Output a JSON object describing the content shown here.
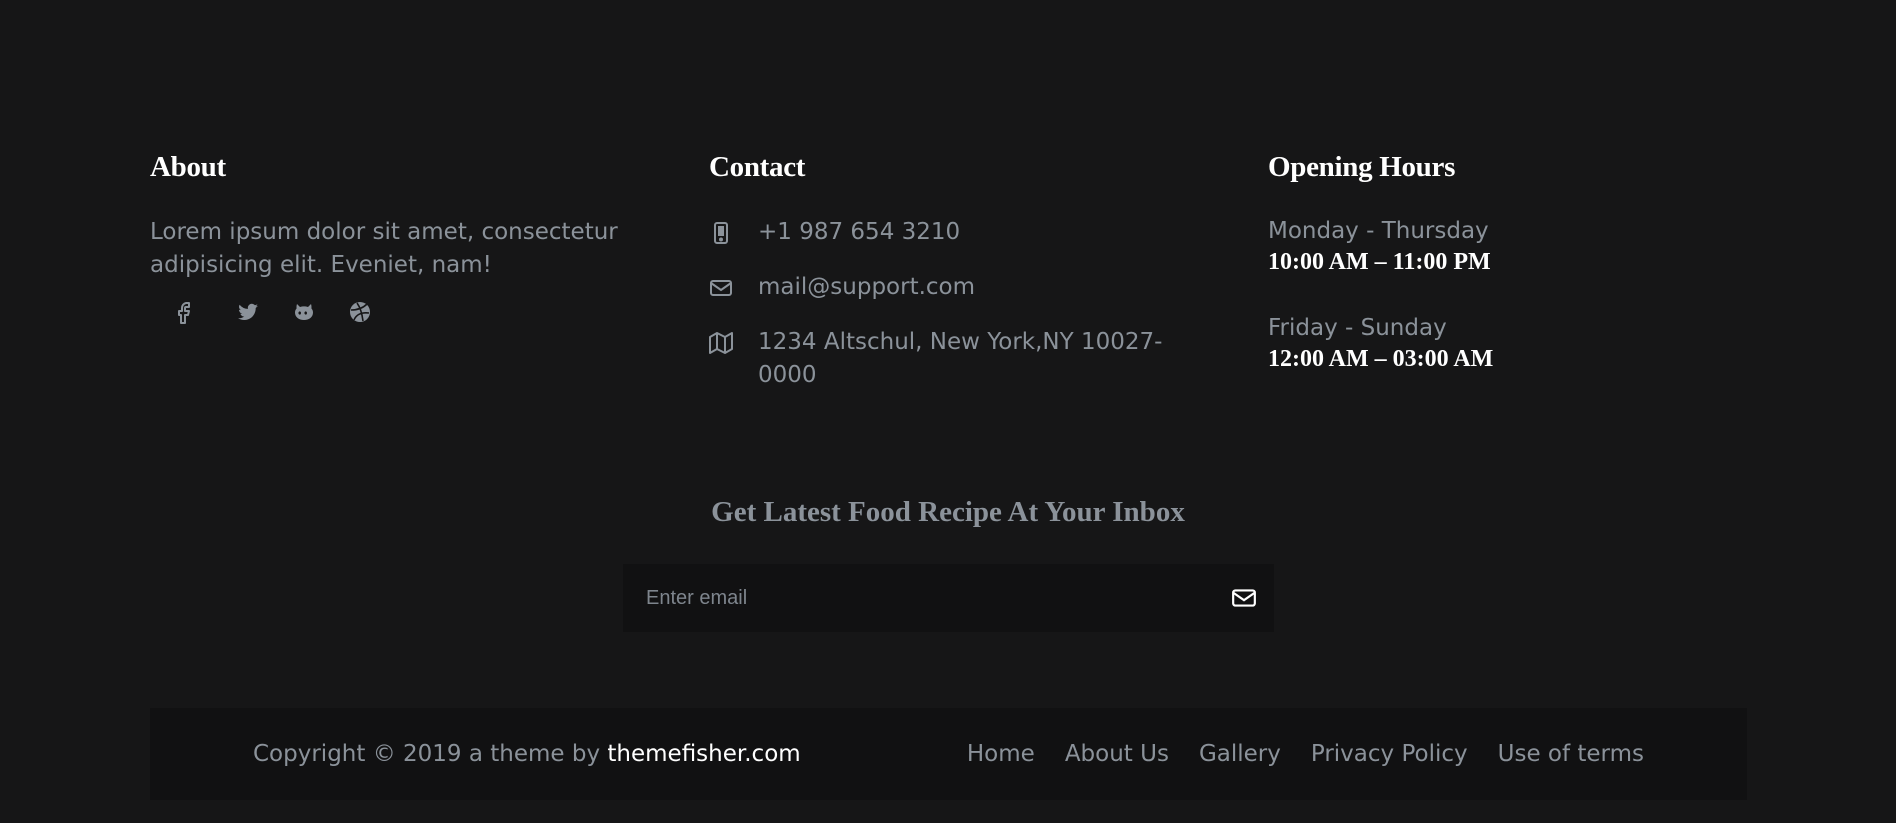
{
  "about": {
    "title": "About",
    "text": "Lorem ipsum dolor sit amet, consectetur adipisicing elit. Eveniet, nam!",
    "social": [
      {
        "icon": "facebook-icon"
      },
      {
        "icon": "twitter-icon"
      },
      {
        "icon": "github-icon"
      },
      {
        "icon": "dribbble-icon"
      }
    ]
  },
  "contact": {
    "title": "Contact",
    "phone": "+1 987 654 3210",
    "email": "mail@support.com",
    "address": "1234 Altschul, New York,NY 10027-0000"
  },
  "hours": {
    "title": "Opening Hours",
    "slots": [
      {
        "days": "Monday - Thursday",
        "time": "10:00 AM – 11:00 PM"
      },
      {
        "days": "Friday - Sunday",
        "time": "12:00 AM – 03:00 AM"
      }
    ]
  },
  "newsletter": {
    "title": "Get Latest Food Recipe At Your Inbox",
    "placeholder": "Enter email"
  },
  "footer": {
    "copyright_prefix": "Copyright © 2019 a theme by ",
    "brand": "themefisher.com",
    "nav": [
      "Home",
      "About Us",
      "Gallery",
      "Privacy Policy",
      "Use of terms"
    ]
  },
  "colors": {
    "background": "#161617",
    "muted_text": "#8b929a",
    "heading": "#ffffff",
    "panel": "#111112"
  }
}
